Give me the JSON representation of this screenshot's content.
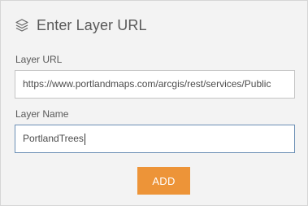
{
  "header": {
    "title": "Enter Layer URL",
    "icon": "layers-icon"
  },
  "form": {
    "url_label": "Layer URL",
    "url_value": "https://www.portlandmaps.com/arcgis/rest/services/Public",
    "name_label": "Layer Name",
    "name_value": "PortlandTrees"
  },
  "actions": {
    "add_label": "ADD"
  },
  "colors": {
    "accent": "#ed9438",
    "focus_border": "#6b8fb5",
    "panel_bg": "#f3f3f3"
  }
}
